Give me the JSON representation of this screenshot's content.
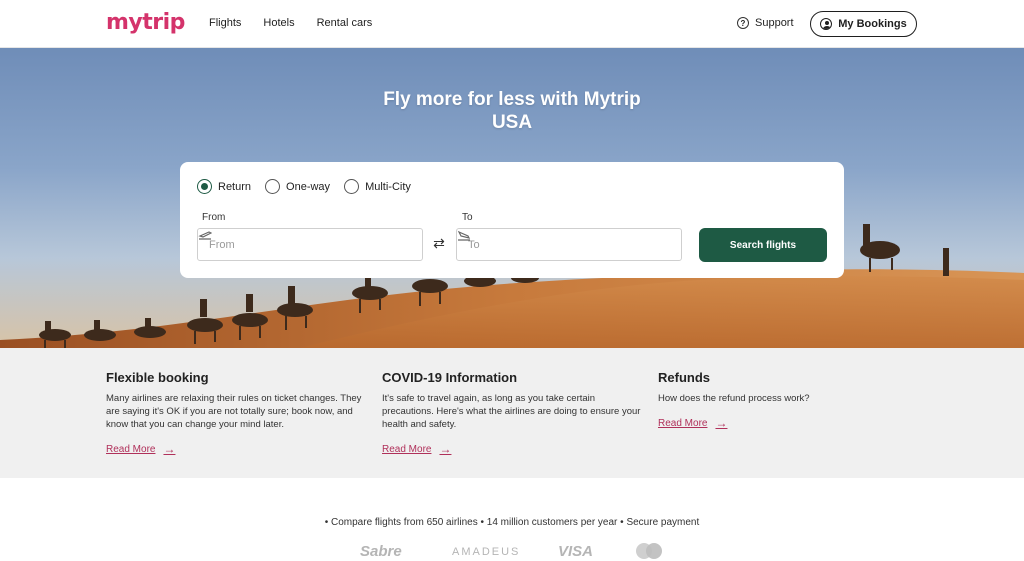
{
  "brand": {
    "name": "mytrip",
    "color": "#d4336b"
  },
  "nav": [
    {
      "label": "Flights"
    },
    {
      "label": "Hotels"
    },
    {
      "label": "Rental cars"
    }
  ],
  "header": {
    "support_label": "Support",
    "support_icon": "help-circle-icon",
    "bookings_label": "My Bookings",
    "bookings_icon": "user-icon"
  },
  "hero": {
    "title_line1": "Fly more for less with Mytrip",
    "title_line2": "USA"
  },
  "search": {
    "trip_types": [
      {
        "label": "Return",
        "checked": true
      },
      {
        "label": "One-way",
        "checked": false
      },
      {
        "label": "Multi-City",
        "checked": false
      }
    ],
    "from_label": "From",
    "from_placeholder": "From",
    "to_label": "To",
    "to_placeholder": "To",
    "button_label": "Search flights",
    "button_color": "#1e5a44"
  },
  "info": [
    {
      "title": "Flexible booking",
      "body": "Many airlines are relaxing their rules on ticket changes. They are saying it's OK if you are not totally sure; book now, and know that you can change your mind later.",
      "link": "Read More"
    },
    {
      "title": "COVID-19 Information",
      "body": "It's safe to travel again, as long as you take certain precautions. Here's what the airlines are doing to ensure your health and safety.",
      "link": "Read More"
    },
    {
      "title": "Refunds",
      "body": "How does the refund process work?",
      "link": "Read More"
    }
  ],
  "trust": {
    "text": "• Compare flights from 650 airlines  • 14 million customers per year  • Secure payment"
  },
  "partners": [
    {
      "name": "Sabre"
    },
    {
      "name": "AMADEUS"
    },
    {
      "name": "VISA"
    },
    {
      "name": "mastercard-icon"
    }
  ]
}
